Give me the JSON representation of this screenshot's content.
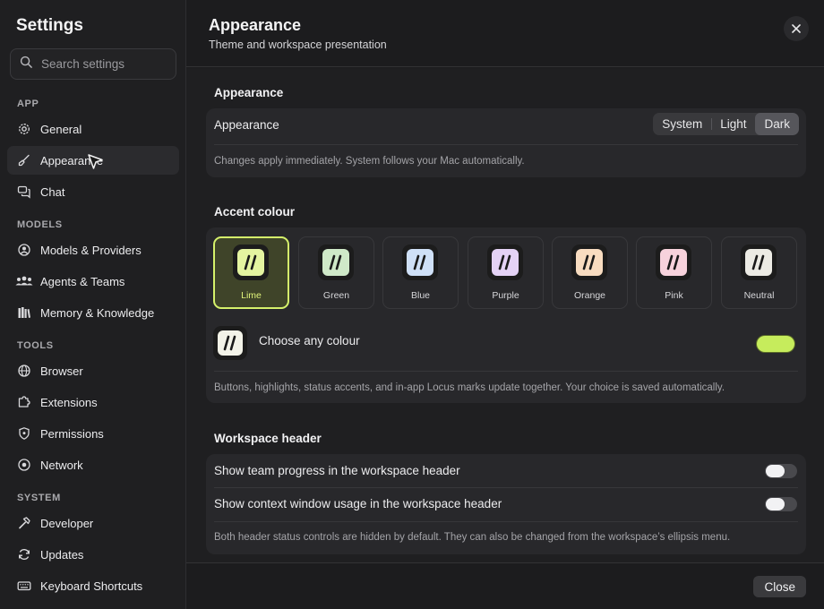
{
  "sidebar": {
    "title": "Settings",
    "search_placeholder": "Search settings",
    "sections": [
      {
        "label": "APP",
        "items": [
          {
            "label": "General",
            "icon": "gear-icon"
          },
          {
            "label": "Appearance",
            "icon": "brush-icon",
            "active": true
          },
          {
            "label": "Chat",
            "icon": "chat-bubbles-icon"
          }
        ]
      },
      {
        "label": "MODELS",
        "items": [
          {
            "label": "Models & Providers",
            "icon": "user-circle-icon"
          },
          {
            "label": "Agents & Teams",
            "icon": "people-icon"
          },
          {
            "label": "Memory & Knowledge",
            "icon": "books-icon"
          }
        ]
      },
      {
        "label": "TOOLS",
        "items": [
          {
            "label": "Browser",
            "icon": "globe-icon"
          },
          {
            "label": "Extensions",
            "icon": "puzzle-icon"
          },
          {
            "label": "Permissions",
            "icon": "shield-icon"
          },
          {
            "label": "Network",
            "icon": "network-icon"
          }
        ]
      },
      {
        "label": "SYSTEM",
        "items": [
          {
            "label": "Developer",
            "icon": "hammer-icon"
          },
          {
            "label": "Updates",
            "icon": "refresh-icon"
          },
          {
            "label": "Keyboard Shortcuts",
            "icon": "keyboard-icon"
          }
        ]
      }
    ]
  },
  "header": {
    "title": "Appearance",
    "subtitle": "Theme and workspace presentation"
  },
  "appearance_section": {
    "heading": "Appearance",
    "row_label": "Appearance",
    "options": [
      "System",
      "Light",
      "Dark"
    ],
    "selected": "Dark",
    "hint": "Changes apply immediately. System follows your Mac automatically."
  },
  "accent_section": {
    "heading": "Accent colour",
    "swatches": [
      {
        "label": "Lime",
        "color": "#e4f4a0",
        "selected": true
      },
      {
        "label": "Green",
        "color": "#cfe9c8"
      },
      {
        "label": "Blue",
        "color": "#cfe0f7"
      },
      {
        "label": "Purple",
        "color": "#e4d2f5"
      },
      {
        "label": "Orange",
        "color": "#f8dcc0"
      },
      {
        "label": "Pink",
        "color": "#f7d2dc"
      },
      {
        "label": "Neutral",
        "color": "#ecebe4"
      }
    ],
    "custom_label": "Choose any colour",
    "custom_color": "#c6ec5c",
    "hint": "Buttons, highlights, status accents, and in-app Locus marks update together. Your choice is saved automatically."
  },
  "workspace_section": {
    "heading": "Workspace header",
    "rows": [
      {
        "label": "Show team progress in the workspace header",
        "on": false
      },
      {
        "label": "Show context window usage in the workspace header",
        "on": false
      }
    ],
    "hint": "Both header status controls are hidden by default. They can also be changed from the workspace’s ellipsis menu."
  },
  "footer": {
    "close_label": "Close"
  }
}
